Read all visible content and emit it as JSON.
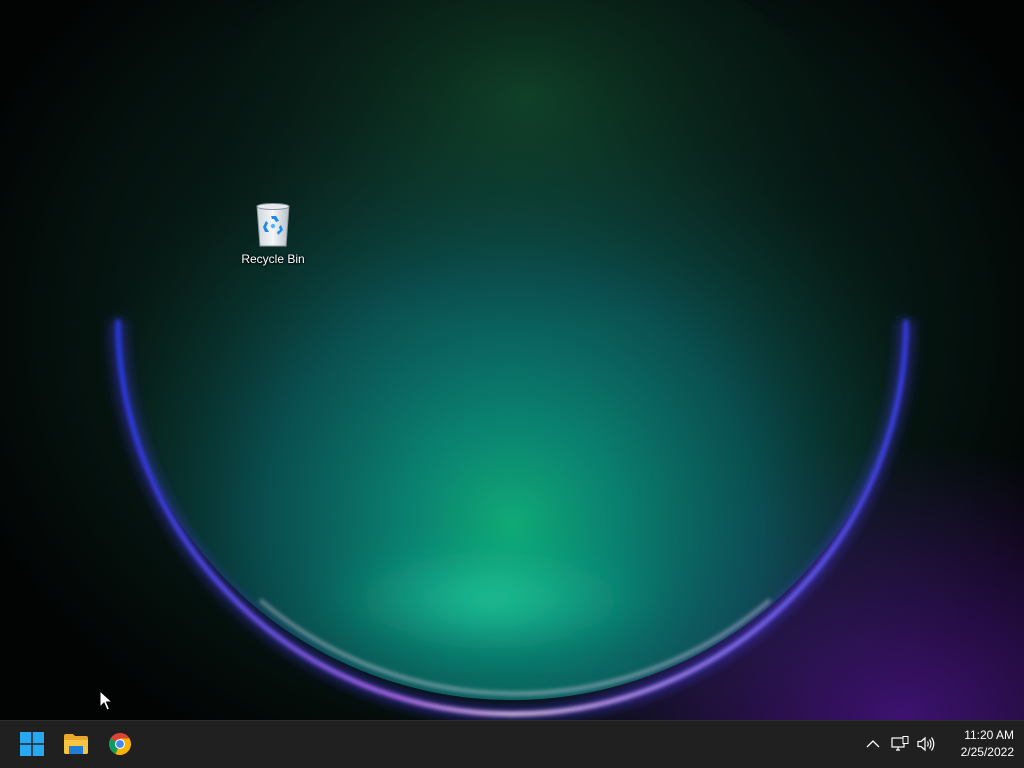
{
  "desktop": {
    "icons": [
      {
        "label": "Recycle Bin",
        "icon": "recycle-bin-icon"
      }
    ]
  },
  "taskbar": {
    "pinned": [
      {
        "name": "Start",
        "icon": "windows-logo-icon"
      },
      {
        "name": "File Explorer",
        "icon": "folder-icon"
      },
      {
        "name": "Google Chrome",
        "icon": "chrome-icon"
      }
    ],
    "tray": {
      "icons": [
        "chevron-up-icon",
        "network-icon",
        "volume-icon"
      ],
      "time": "11:20 AM",
      "date": "2/25/2022"
    }
  },
  "colors": {
    "taskbar_bg": "#202020",
    "windows_blue": "#29a8f0",
    "folder_yellow": "#f6c343"
  }
}
